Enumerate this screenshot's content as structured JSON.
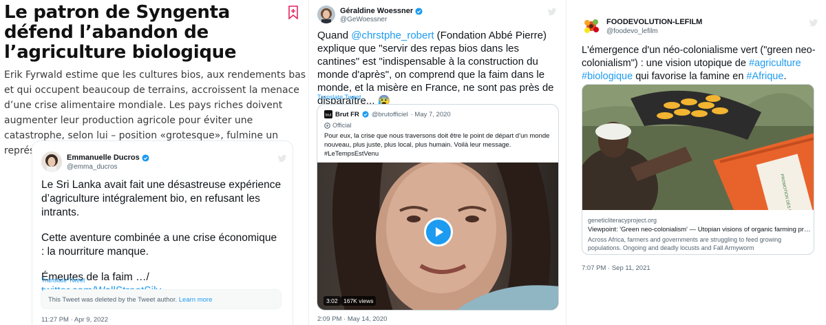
{
  "article": {
    "headline": "Le patron de Syngenta défend l’abandon de l’agriculture biologique",
    "lede": "Erik Fyrwald estime que les cultures bios, aux rendements bas et qui occupent beaucoup de terrains, accroissent la menace d’une crise alimentaire mondiale. Les pays riches doivent augmenter leur production agricole pour éviter une catastrophe, selon lui – position «grotesque», fulmine un représentant du bio",
    "bookmark_icon": "bookmark-icon",
    "embed": {
      "author_name": "Emmanuelle Ducros",
      "author_handle": "@emma_ducros",
      "paragraph1": "Le Sri Lanka avait fait une désastreuse expérience d’agriculture intégralement bio, en refusant les intrants.",
      "paragraph2": "Cette aventure combinée a une crise économique : la nourriture manque.",
      "paragraph3_text": "Émeutes de la faim …/ ",
      "paragraph3_link": "twitter.com/WallStreetSilv…",
      "translate": "Translate Tweet",
      "deleted_notice": "This Tweet was deleted by the Tweet author. ",
      "learn_more": "Learn more",
      "timestamp": "11:27 PM · Apr 9, 2022"
    }
  },
  "tweet2": {
    "author_name": "Géraldine Woessner",
    "author_handle": "@GeWoessner",
    "text_before": "Quand ",
    "mention": "@chrstphe_robert",
    "text_after": " (Fondation Abbé Pierre) explique que \"servir des repas bios dans les cantines\" est \"indispensable à la construction du monde d'après\", on comprend que la faim dans le monde, et la misère en France, ne sont pas près de disparaître... 😰",
    "translate": "Translate Tweet",
    "quote": {
      "name": "Brut FR",
      "handle": "@brutofficiel",
      "date": "· May 7, 2020",
      "official": "Official",
      "text": "Pour eux, la crise que nous traversons doit être le point de départ d’un monde nouveau, plus juste, plus local, plus humain. Voilà leur message.",
      "hashtag": "#LeTempsEstVenu",
      "duration": "3:02",
      "views": "167K views"
    },
    "timestamp": "2:09 PM · May 14, 2020"
  },
  "tweet3": {
    "author_name": "FOODEVOLUTION-LEFILM",
    "author_handle": "@foodevo_lefilm",
    "text_1": "L'émergence d'un néo-colonialisme vert (\"green neo-colonialism\") : une vision utopique de ",
    "tag_1": "#agriculture",
    "text_2": " ",
    "tag_2": "#biologique",
    "text_3": " qui favorise la famine en ",
    "tag_3": "#Afrique",
    "text_4": ".",
    "card": {
      "domain": "geneticliteracyproject.org",
      "title": "Viewpoint: 'Green neo-colonialism' — Utopian visions of organic farming prom…",
      "description": "Across Africa, farmers and governments are struggling to feed growing populations. Ongoing and deadly locusts and Fall Armyworm",
      "photo_sign": "PROMOTION DES FEC"
    },
    "timestamp": "7:07 PM · Sep 11, 2021"
  },
  "colors": {
    "link": "#1d9bf0",
    "secondary_text": "#536471",
    "bookmark": "#e0245e"
  }
}
